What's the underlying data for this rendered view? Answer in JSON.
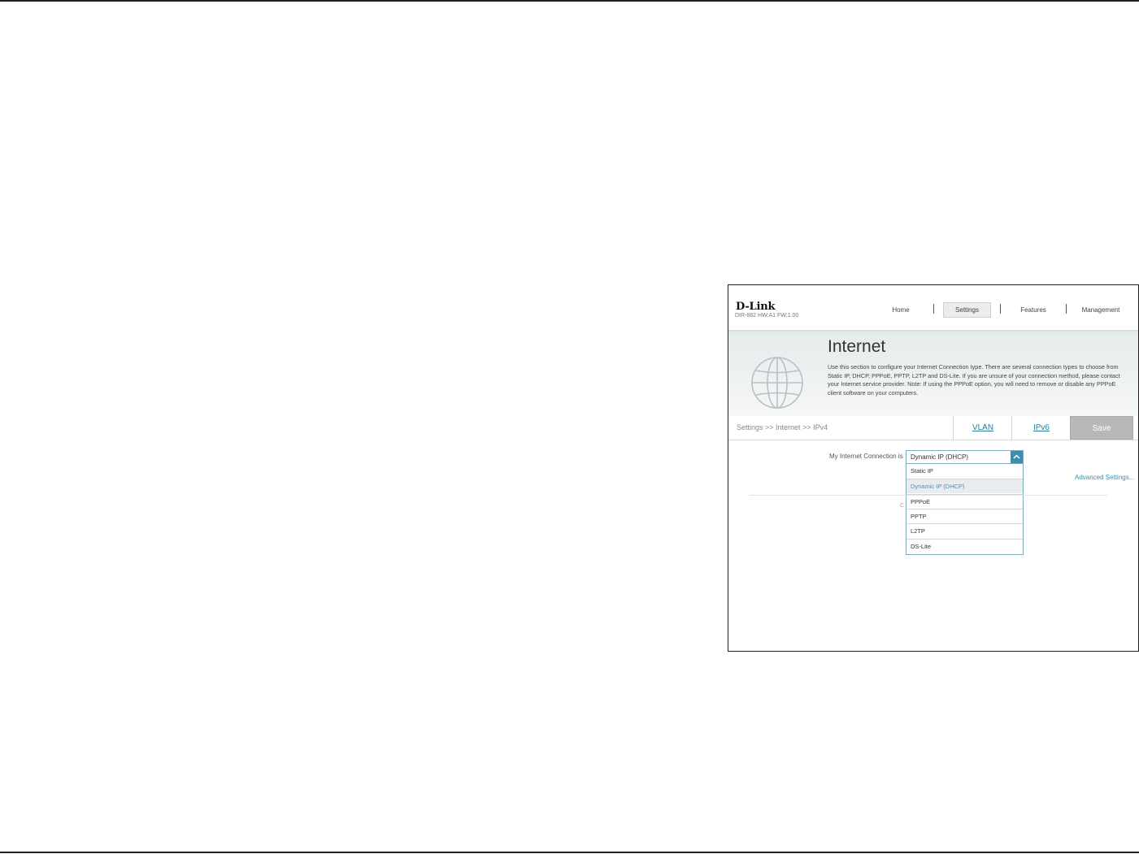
{
  "router": {
    "brand": "D-Link",
    "model_info": "DIR-882 HW:A1 FW:1.00",
    "nav": [
      "Home",
      "Settings",
      "Features",
      "Management"
    ],
    "active_nav": "Settings"
  },
  "page": {
    "title": "Internet",
    "description": "Use this section to configure your Internet Connection type. There are several connection types to choose from Static IP, DHCP, PPPoE, PPTP, L2TP and DS-Lite. If you are unsure of your connection method, please contact your Internet service provider. Note: If using the PPPoE option, you will need to remove or disable any PPPoE client software on your computers."
  },
  "breadcrumb": "Settings >> Internet >> IPv4",
  "tabs": [
    "VLAN",
    "IPv6"
  ],
  "save_label": "Save",
  "connection": {
    "label": "My Internet Connection is",
    "selected": "Dynamic IP (DHCP)",
    "options": [
      "Static IP",
      "Dynamic IP (DHCP)",
      "PPPoE",
      "PPTP",
      "L2TP",
      "DS-Lite"
    ]
  },
  "advanced_link": "Advanced Settings...",
  "partial_text": "C",
  "colors": {
    "accent": "#3a8fb0",
    "link": "#2b7c9a",
    "save_bg": "#b8b8b8"
  }
}
